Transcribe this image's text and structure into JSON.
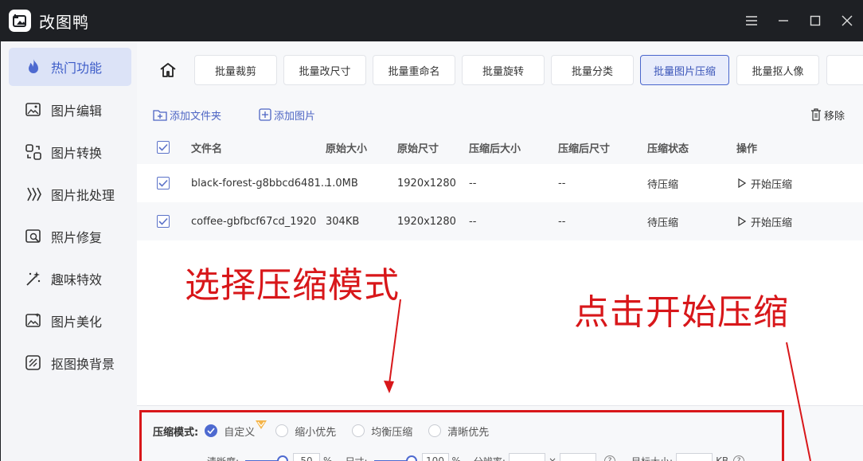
{
  "app": {
    "title": "改图鸭"
  },
  "sidebar": {
    "items": [
      {
        "label": "热门功能",
        "icon": "flame-icon",
        "active": true
      },
      {
        "label": "图片编辑",
        "icon": "image-edit-icon"
      },
      {
        "label": "图片转换",
        "icon": "image-convert-icon"
      },
      {
        "label": "图片批处理",
        "icon": "batch-process-icon"
      },
      {
        "label": "照片修复",
        "icon": "photo-repair-icon"
      },
      {
        "label": "趣味特效",
        "icon": "magic-wand-icon"
      },
      {
        "label": "图片美化",
        "icon": "image-beautify-icon"
      },
      {
        "label": "抠图换背景",
        "icon": "cutout-icon"
      }
    ]
  },
  "tabs": [
    {
      "label": "批量裁剪"
    },
    {
      "label": "批量改尺寸"
    },
    {
      "label": "批量重命名"
    },
    {
      "label": "批量旋转"
    },
    {
      "label": "批量分类"
    },
    {
      "label": "批量图片压缩",
      "active": true
    },
    {
      "label": "批量抠人像"
    }
  ],
  "toolbar": {
    "add_folder": "添加文件夹",
    "add_image": "添加图片",
    "remove": "移除"
  },
  "table": {
    "headers": [
      "文件名",
      "原始大小",
      "原始尺寸",
      "压缩后大小",
      "压缩后尺寸",
      "压缩状态",
      "操作"
    ],
    "rows": [
      {
        "name": "black-forest-g8bbcd6481...",
        "size": "1.0MB",
        "dims": "1920x1280",
        "new_size": "--",
        "new_dims": "--",
        "status": "待压缩",
        "action": "开始压缩"
      },
      {
        "name": "coffee-gbfbcf67cd_1920",
        "size": "304KB",
        "dims": "1920x1280",
        "new_size": "--",
        "new_dims": "--",
        "status": "待压缩",
        "action": "开始压缩"
      }
    ]
  },
  "annotations": {
    "left": "选择压缩模式",
    "right": "点击开始压缩"
  },
  "compress": {
    "mode_label": "压缩模式:",
    "options": [
      {
        "label": "自定义",
        "selected": true
      },
      {
        "label": "缩小优先"
      },
      {
        "label": "均衡压缩"
      },
      {
        "label": "清晰优先"
      }
    ],
    "clarity_label": "清晰度:",
    "clarity_value": "50",
    "clarity_unit": "%",
    "size_label": "尺寸:",
    "size_value": "100",
    "size_unit": "%",
    "resolution_label": "分辨率:",
    "target_label": "目标大小:",
    "target_unit": "KB"
  },
  "colors": {
    "accent": "#4e6ad0",
    "annotation_red": "#d8171a",
    "titlebar": "#1e2024"
  }
}
